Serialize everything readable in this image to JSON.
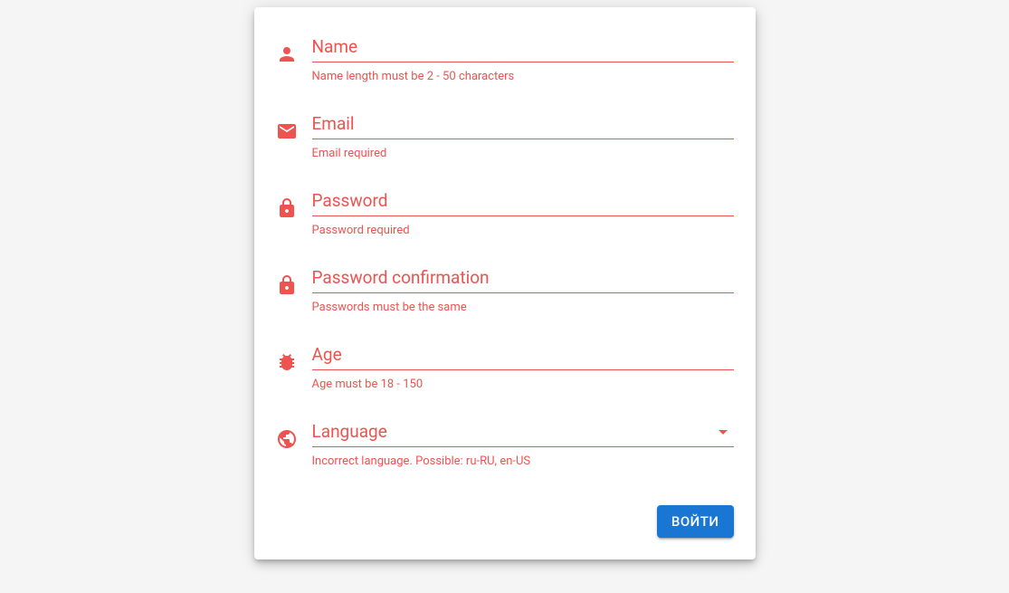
{
  "colors": {
    "error": "#ef5350",
    "primary": "#1976d2"
  },
  "form": {
    "fields": {
      "name": {
        "label": "Name",
        "error": "Name length must be 2 - 50 characters",
        "icon": "person"
      },
      "email": {
        "label": "Email",
        "error": "Email required",
        "icon": "email"
      },
      "password": {
        "label": "Password",
        "error": "Password required",
        "icon": "lock"
      },
      "password_confirm": {
        "label": "Password confirmation",
        "error": "Passwords must be the same",
        "icon": "lock"
      },
      "age": {
        "label": "Age",
        "error": "Age must be 18 - 150",
        "icon": "bug"
      },
      "language": {
        "label": "Language",
        "error": "Incorrect language. Possible: ru-RU, en-US",
        "icon": "language"
      }
    },
    "submit_label": "ВОЙТИ"
  }
}
